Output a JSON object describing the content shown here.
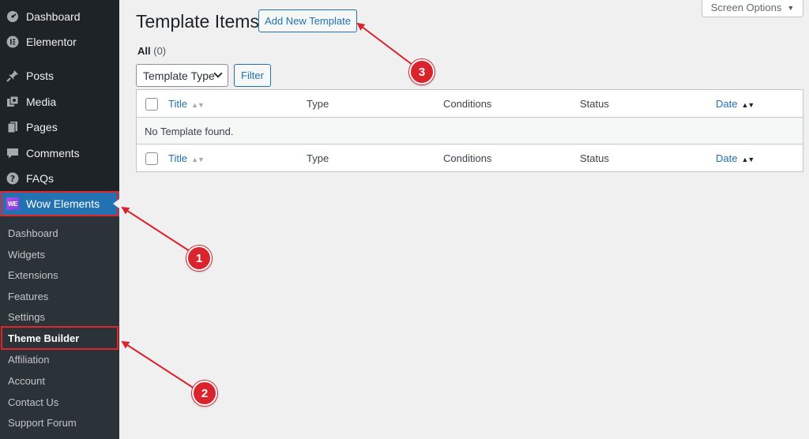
{
  "sidebar": {
    "items": [
      {
        "label": "Dashboard",
        "icon": "dashboard-icon"
      },
      {
        "label": "Elementor",
        "icon": "elementor-icon"
      },
      {
        "label": "Posts",
        "icon": "pin-icon"
      },
      {
        "label": "Media",
        "icon": "media-icon"
      },
      {
        "label": "Pages",
        "icon": "pages-icon"
      },
      {
        "label": "Comments",
        "icon": "comment-icon"
      },
      {
        "label": "FAQs",
        "icon": "help-icon"
      },
      {
        "label": "Wow Elements",
        "icon": "wow-elements-logo-icon"
      }
    ],
    "submenu": [
      "Dashboard",
      "Widgets",
      "Extensions",
      "Features",
      "Settings",
      "Theme Builder",
      "Affiliation",
      "Account",
      "Contact Us",
      "Support Forum"
    ],
    "wow_logo_text": "WE"
  },
  "main": {
    "title": "Template Items",
    "add_new_label": "Add New Template",
    "screen_options_label": "Screen Options",
    "filter_all_label": "All",
    "filter_all_count": "(0)",
    "template_type_label": "Template Type",
    "filter_button_label": "Filter",
    "table": {
      "columns": [
        "Title",
        "Type",
        "Conditions",
        "Status",
        "Date"
      ],
      "empty_message": "No Template found."
    }
  },
  "annotations": [
    "1",
    "2",
    "3"
  ],
  "colors": {
    "accent": "#2271b1",
    "sidebar": "#1d2327",
    "annotation": "#d9232d"
  }
}
